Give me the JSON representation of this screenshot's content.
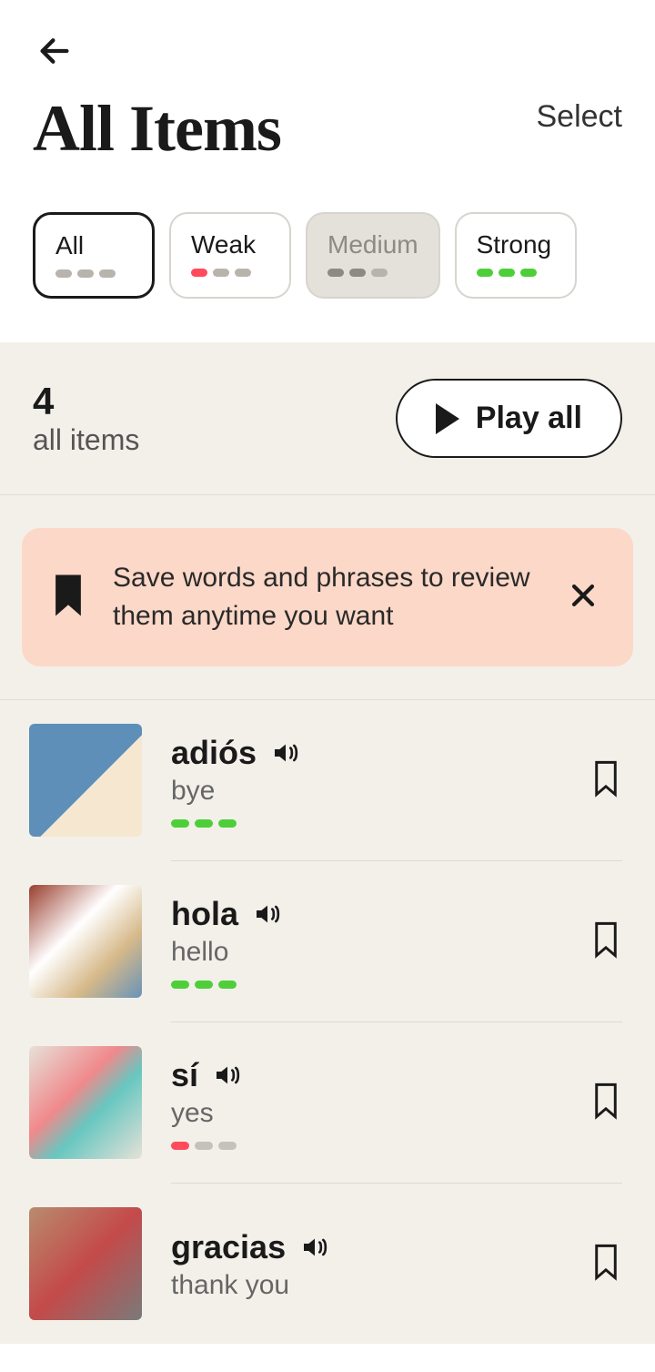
{
  "header": {
    "title": "All Items",
    "select_label": "Select"
  },
  "filters": [
    {
      "label": "All",
      "dots": [
        "gray",
        "gray",
        "gray"
      ],
      "state": "active"
    },
    {
      "label": "Weak",
      "dots": [
        "red",
        "gray",
        "gray"
      ],
      "state": "normal"
    },
    {
      "label": "Medium",
      "dots": [
        "gray2",
        "gray2",
        "gray"
      ],
      "state": "disabled"
    },
    {
      "label": "Strong",
      "dots": [
        "green",
        "green",
        "green"
      ],
      "state": "normal"
    }
  ],
  "summary": {
    "count": "4",
    "label": "all items",
    "play_all_label": "Play all"
  },
  "tip": {
    "text": "Save words and phrases to review them anytime you want"
  },
  "items": [
    {
      "word": "adiós",
      "translation": "bye",
      "strength": [
        "green",
        "green",
        "green"
      ]
    },
    {
      "word": "hola",
      "translation": "hello",
      "strength": [
        "green",
        "green",
        "green"
      ]
    },
    {
      "word": "sí",
      "translation": "yes",
      "strength": [
        "red",
        "gray",
        "gray"
      ]
    },
    {
      "word": "gracias",
      "translation": "thank you",
      "strength": []
    }
  ]
}
